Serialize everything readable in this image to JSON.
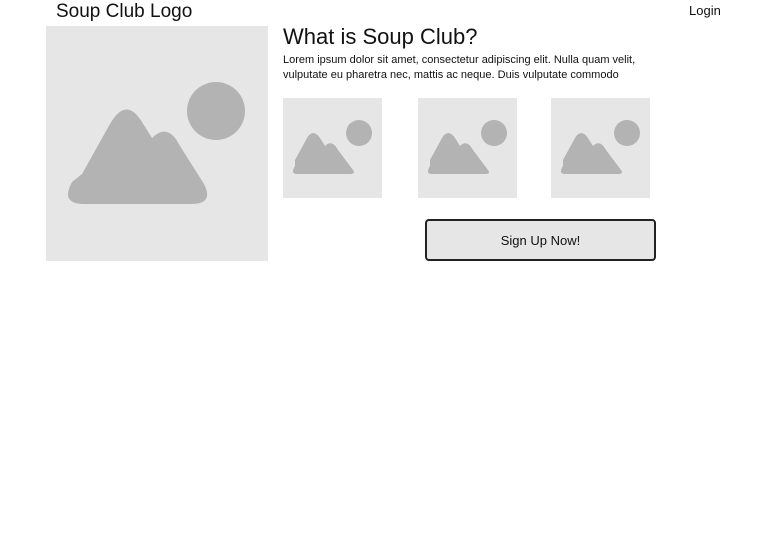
{
  "header": {
    "logo_text": "Soup Club Logo",
    "login_label": "Login"
  },
  "main": {
    "title": "What is Soup Club?",
    "description": "Lorem ipsum dolor sit amet, consectetur adipiscing elit. Nulla quam velit, vulputate eu pharetra nec, mattis ac neque. Duis vulputate commodo",
    "signup_label": "Sign Up Now!"
  },
  "colors": {
    "placeholder_bg": "#e6e6e6",
    "placeholder_shape": "#b3b3b3",
    "button_border": "#222222"
  },
  "icons": {
    "hero": "image-placeholder-icon",
    "thumbnails": [
      "image-placeholder-icon",
      "image-placeholder-icon",
      "image-placeholder-icon"
    ]
  }
}
